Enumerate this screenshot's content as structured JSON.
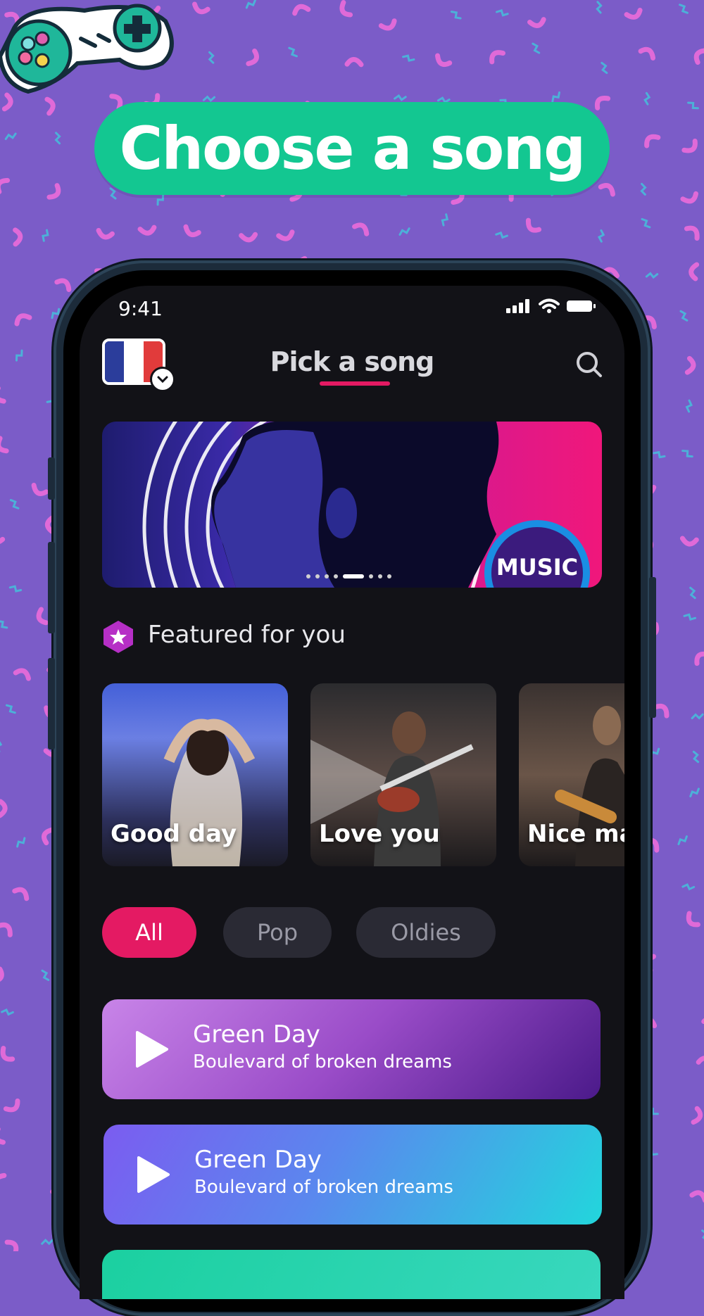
{
  "headline": "Choose a song",
  "status": {
    "time": "9:41"
  },
  "header": {
    "title": "Pick a song"
  },
  "banner": {
    "badge": "MUSIC",
    "slide_count": 8,
    "active_slide": 4
  },
  "featured": {
    "heading": "Featured for you",
    "cards": [
      {
        "label": "Good day"
      },
      {
        "label": "Love you"
      },
      {
        "label": "Nice ma"
      }
    ]
  },
  "filters": [
    {
      "label": "All",
      "active": true
    },
    {
      "label": "Pop",
      "active": false
    },
    {
      "label": "Oldies",
      "active": false
    }
  ],
  "songs": [
    {
      "artist": "Green Day",
      "track": "Boulevard of broken dreams"
    },
    {
      "artist": "Green Day",
      "track": "Boulevard of broken dreams"
    }
  ],
  "colors": {
    "background": "#7b5cc8",
    "headline_pill": "#13c791",
    "accent": "#e41a63",
    "screen": "#121217"
  },
  "icons": [
    "gamepad-icon",
    "french-flag-icon",
    "chevron-down-icon",
    "search-icon",
    "star-hexagon-icon",
    "play-icon",
    "signal-icon",
    "wifi-icon",
    "battery-icon"
  ]
}
